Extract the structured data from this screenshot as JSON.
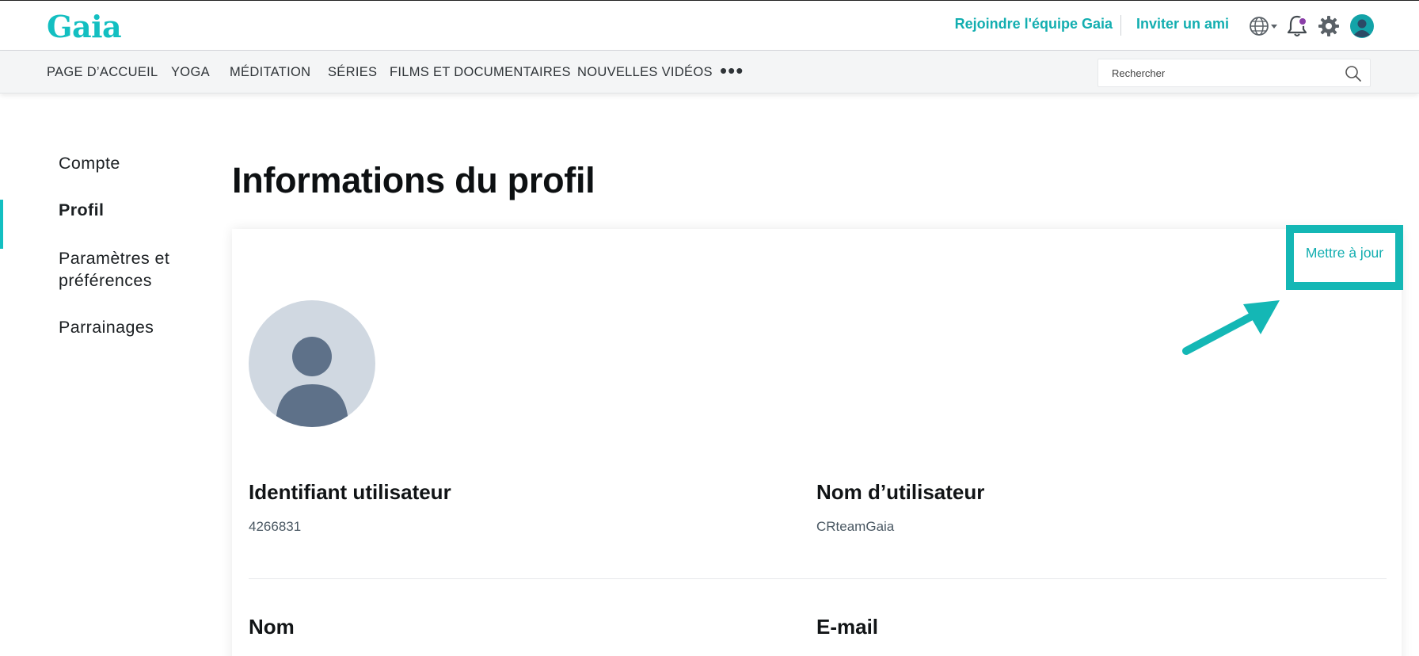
{
  "header": {
    "logo": "Gaia",
    "join_link": "Rejoindre l'équipe Gaia",
    "invite_link": "Inviter un ami",
    "icons": [
      "globe-icon",
      "bell-icon",
      "gear-icon",
      "user-avatar-icon"
    ]
  },
  "nav": {
    "items": [
      {
        "label": "PAGE D’ACCUEIL"
      },
      {
        "label": "YOGA"
      },
      {
        "label": "MÉDITATION"
      },
      {
        "label": "SÉRIES"
      },
      {
        "label": "FILMS ET DOCUMENTAIRES"
      },
      {
        "label": "NOUVELLES VIDÉOS"
      }
    ],
    "more": "•••",
    "search_placeholder": "Rechercher"
  },
  "sidebar": {
    "items": [
      {
        "label": "Compte"
      },
      {
        "label": "Profil"
      },
      {
        "label": "Paramètres et"
      },
      {
        "label": "préférences"
      },
      {
        "label": "Parrainages"
      }
    ],
    "active": "Profil"
  },
  "main": {
    "title": "Informations du profil",
    "update_button": "Mettre à jour",
    "fields": {
      "user_id_label": "Identifiant utilisateur",
      "user_id_value": "4266831",
      "username_label": "Nom d’utilisateur",
      "username_value": "CRteamGaia",
      "name_label": "Nom",
      "email_label": "E-mail"
    }
  },
  "colors": {
    "brand": "#13bfc1",
    "highlight_box": "#14b7b5",
    "notification_dot": "#8a3ea8"
  }
}
